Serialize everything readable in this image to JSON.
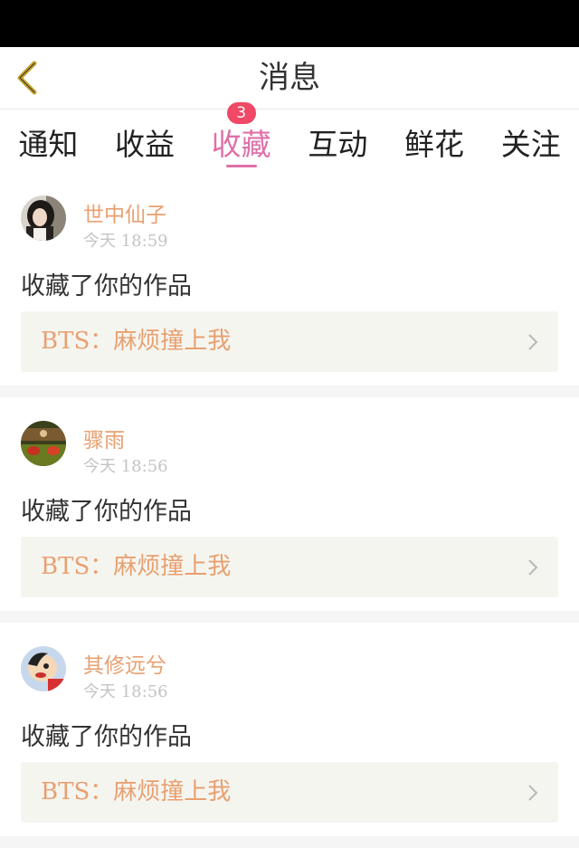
{
  "header": {
    "title": "消息"
  },
  "tabs": [
    {
      "label": "通知",
      "active": false
    },
    {
      "label": "收益",
      "active": false
    },
    {
      "label": "收藏",
      "active": true,
      "badge": "3"
    },
    {
      "label": "互动",
      "active": false
    },
    {
      "label": "鲜花",
      "active": false
    },
    {
      "label": "关注",
      "active": false
    }
  ],
  "messages": [
    {
      "user": "世中仙子",
      "time": "今天 18:59",
      "action": "收藏了你的作品",
      "work": "BTS：麻烦撞上我"
    },
    {
      "user": "骤雨",
      "time": "今天 18:56",
      "action": "收藏了你的作品",
      "work": "BTS：麻烦撞上我"
    },
    {
      "user": "其修远兮",
      "time": "今天 18:56",
      "action": "收藏了你的作品",
      "work": "BTS：麻烦撞上我"
    }
  ],
  "colors": {
    "accent_pink": "#e070a8",
    "badge_red": "#f04866",
    "name_orange": "#e8a070",
    "back_gold": "#c8a428"
  }
}
